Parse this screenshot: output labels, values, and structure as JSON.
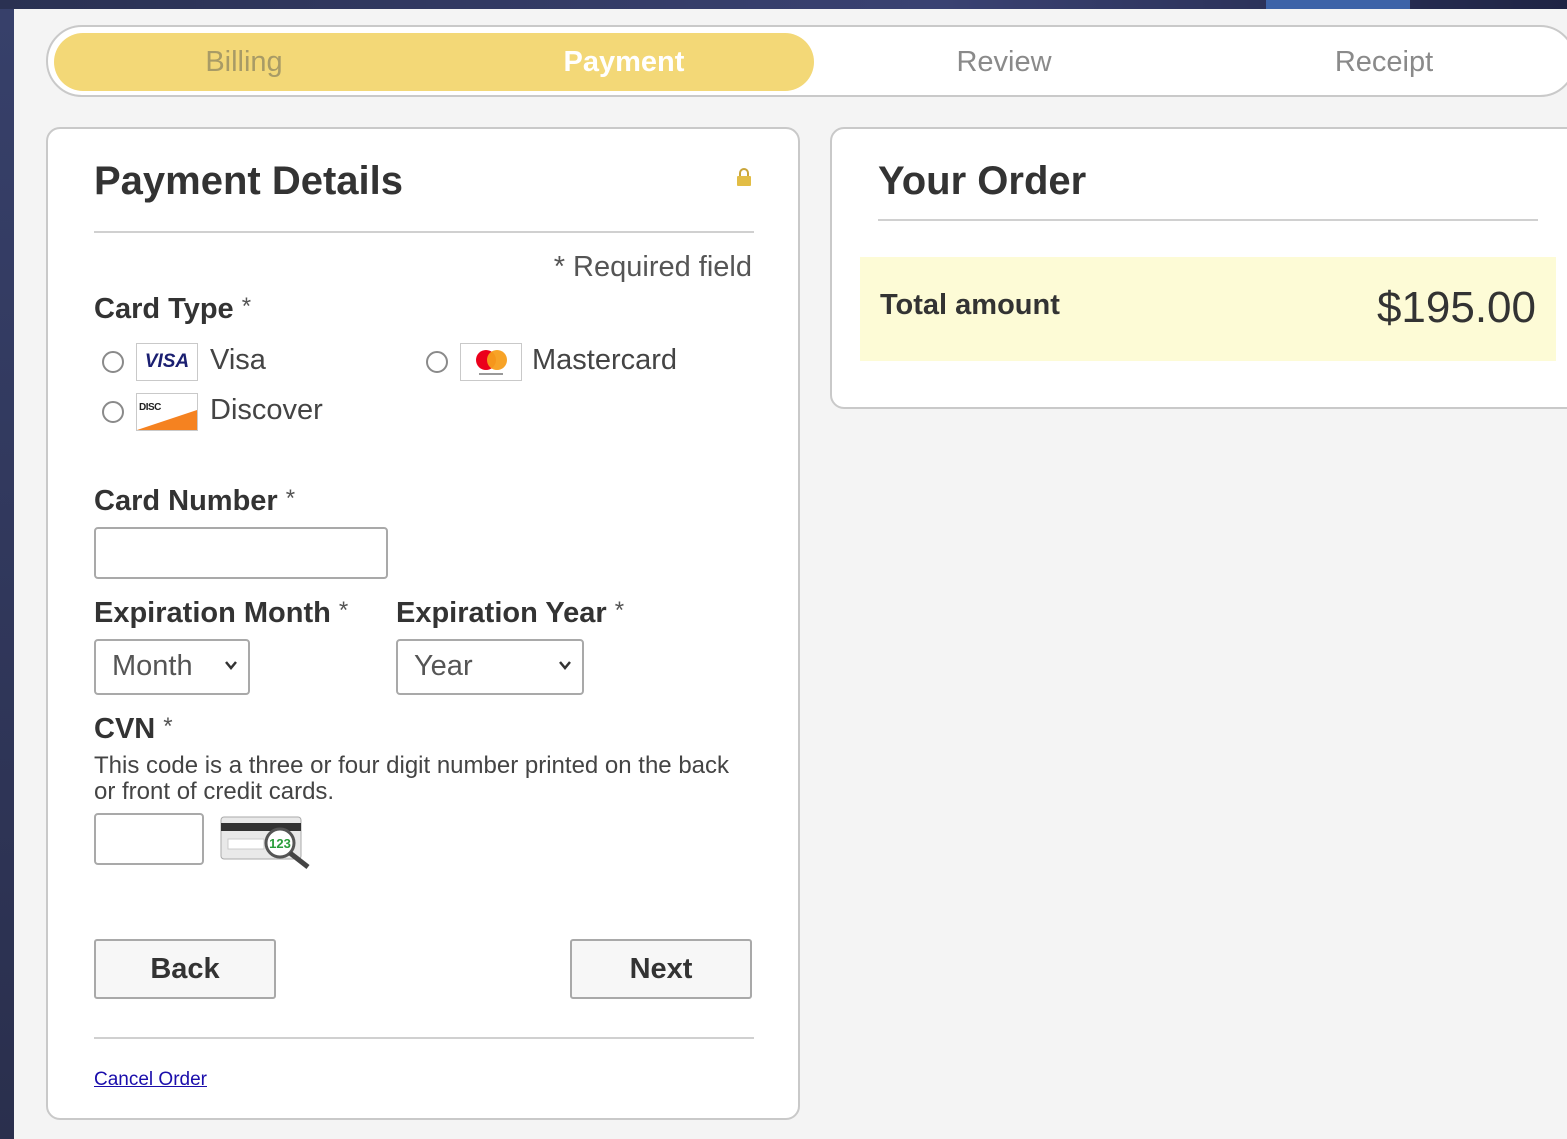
{
  "steps": [
    "Billing",
    "Payment",
    "Review",
    "Receipt"
  ],
  "payment": {
    "title": "Payment Details",
    "required_note": "* Required field",
    "card_type_label": "Card Type",
    "card_types": [
      "Visa",
      "Mastercard",
      "Discover"
    ],
    "card_logos": {
      "visa": "VISA",
      "discover": "DISC"
    },
    "card_number_label": "Card Number",
    "exp_month_label": "Expiration Month",
    "exp_month_value": "Month",
    "exp_year_label": "Expiration Year",
    "exp_year_value": "Year",
    "cvn_label": "CVN",
    "cvn_help": "This code is a three or four digit number printed on the back or front of credit cards.",
    "cvn_image_text": "123",
    "required_star": "*",
    "back_label": "Back",
    "next_label": "Next",
    "cancel_label": "Cancel Order"
  },
  "order": {
    "title": "Your Order",
    "total_label": "Total amount",
    "total_value": "$195.00"
  },
  "colors": {
    "progress_fill": "#f3d877",
    "total_highlight": "#fdfbd6",
    "link": "#1a0dab"
  }
}
